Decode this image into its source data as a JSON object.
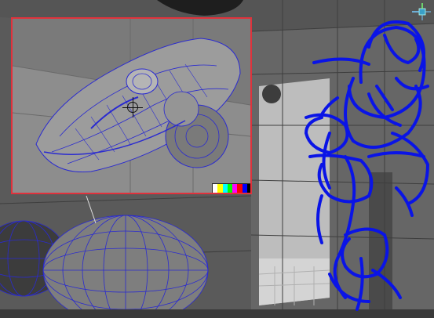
{
  "viewport": {
    "background": "#5d5d5d",
    "wireframe_color": "#2a2ad0",
    "selection_frame_color": "#e0323c",
    "sketch_color": "#0a14e6"
  },
  "inset": {
    "label": "",
    "swatch_colors": [
      "#ffffff",
      "#ffff00",
      "#00ffff",
      "#00ff00",
      "#ff00ff",
      "#ff0000",
      "#0000ff",
      "#000000"
    ]
  },
  "icons": {
    "camera_crosshair": "crosshair-icon",
    "view_cube": "view-cube-icon"
  }
}
